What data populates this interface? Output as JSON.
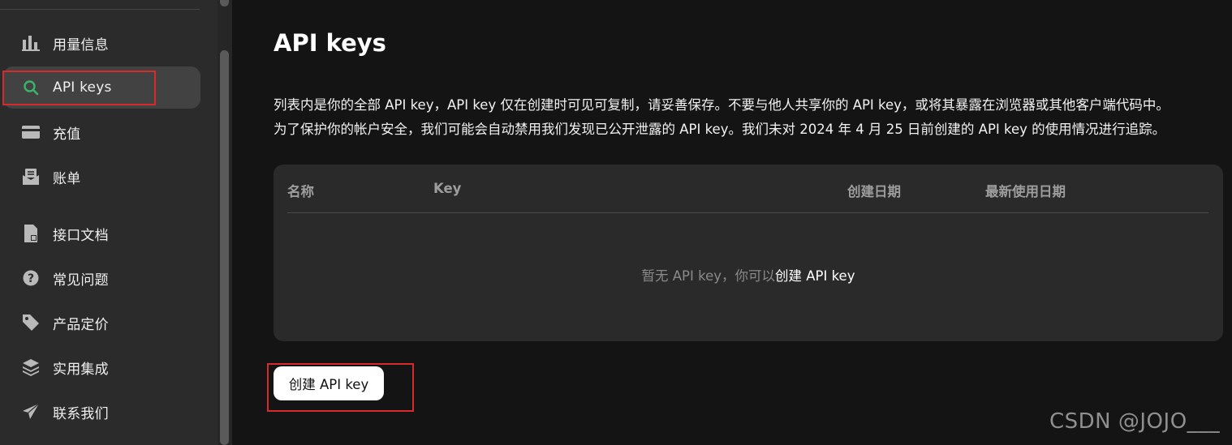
{
  "sidebar": {
    "items": [
      {
        "id": "usage",
        "label": "用量信息",
        "icon": "bar-chart-icon"
      },
      {
        "id": "api-keys",
        "label": "API keys",
        "icon": "search-icon",
        "active": true
      },
      {
        "id": "topup",
        "label": "充值",
        "icon": "wallet-icon"
      },
      {
        "id": "billing",
        "label": "账单",
        "icon": "bill-icon"
      },
      {
        "id": "docs",
        "label": "接口文档",
        "icon": "document-icon"
      },
      {
        "id": "faq",
        "label": "常见问题",
        "icon": "question-icon"
      },
      {
        "id": "pricing",
        "label": "产品定价",
        "icon": "tag-icon"
      },
      {
        "id": "integrations",
        "label": "实用集成",
        "icon": "layers-icon"
      },
      {
        "id": "contact",
        "label": "联系我们",
        "icon": "send-icon"
      }
    ]
  },
  "main": {
    "title": "API keys",
    "description_line1": "列表内是你的全部 API key，API key 仅在创建时可见可复制，请妥善保存。不要与他人共享你的 API key，或将其暴露在浏览器或其他客户端代码中。",
    "description_line2": "为了保护你的帐户安全，我们可能会自动禁用我们发现已公开泄露的 API key。我们未对 2024 年 4 月 25 日前创建的 API key 的使用情况进行追踪。",
    "table": {
      "columns": [
        "名称",
        "Key",
        "创建日期",
        "最新使用日期"
      ],
      "empty_text": "暂无 API key，你可以",
      "empty_link": "创建 API key"
    },
    "create_button": "创建 API key"
  },
  "watermark": "CSDN @JOJO___",
  "colors": {
    "accent_green": "#3bb46a",
    "highlight_red": "#d52b2b",
    "sidebar_bg": "#2b2b2b",
    "main_bg": "#151415"
  }
}
